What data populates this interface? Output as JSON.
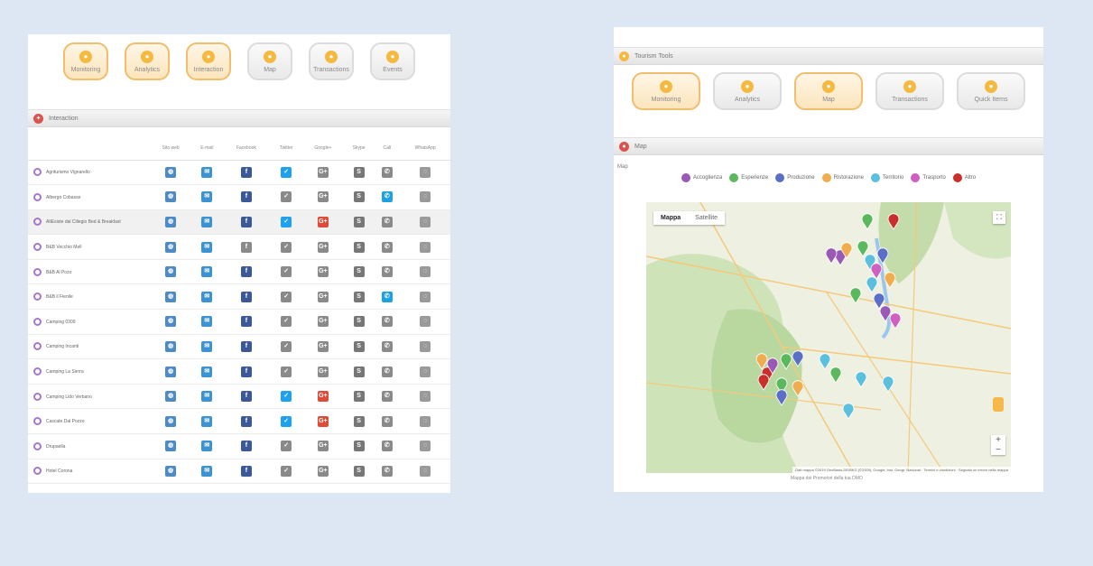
{
  "left": {
    "toolbar": [
      {
        "label": "Monitoring",
        "active": true
      },
      {
        "label": "Analytics",
        "active": true
      },
      {
        "label": "Interaction",
        "active": true
      },
      {
        "label": "Map",
        "active": false
      },
      {
        "label": "Transactions",
        "active": false
      },
      {
        "label": "Events",
        "active": false
      }
    ],
    "section_title": "Interaction",
    "columns": [
      "Sito web",
      "E-mail",
      "Facebook",
      "Twitter",
      "Google+",
      "Skype",
      "Call",
      "WhatsApp"
    ],
    "rows": [
      {
        "name": "Agriturismo Vignarello",
        "tw": true,
        "gp": false,
        "call": false
      },
      {
        "name": "Albergo Cobasse",
        "tw": false,
        "gp": false,
        "call": true
      },
      {
        "name": "AltEsiste dal Ciliegio Bed & Breakfast",
        "tw": true,
        "gp": true,
        "call": false
      },
      {
        "name": "B&B Vecchio Mell",
        "tw": false,
        "gp": false,
        "call": false
      },
      {
        "name": "B&B Al Pozo",
        "tw": false,
        "gp": false,
        "call": false
      },
      {
        "name": "B&B il Fienile",
        "tw": false,
        "gp": false,
        "call": true
      },
      {
        "name": "Camping 0309",
        "tw": false,
        "gp": false,
        "call": false
      },
      {
        "name": "Camping Incanti",
        "tw": false,
        "gp": false,
        "call": false
      },
      {
        "name": "Camping La Sierra",
        "tw": false,
        "gp": false,
        "call": false
      },
      {
        "name": "Camping Lido Verbano",
        "tw": true,
        "gp": true,
        "call": false
      },
      {
        "name": "Cascate Dal Pozzo",
        "tw": true,
        "gp": true,
        "call": false
      },
      {
        "name": "Drupaella",
        "tw": false,
        "gp": false,
        "call": false
      },
      {
        "name": "Hotel Corona",
        "tw": false,
        "gp": false,
        "call": false
      }
    ]
  },
  "right": {
    "top_title": "Tourism Tools",
    "toolbar": [
      {
        "label": "Monitoring",
        "active": true
      },
      {
        "label": "Analytics",
        "active": false
      },
      {
        "label": "Map",
        "active": true
      },
      {
        "label": "Transactions",
        "active": false
      },
      {
        "label": "Quick Items",
        "active": false
      }
    ],
    "section_title": "Map",
    "map_label": "Map",
    "legend": [
      {
        "label": "Accoglienza",
        "color": "#9b59b6"
      },
      {
        "label": "Esperienze",
        "color": "#5cb85c"
      },
      {
        "label": "Produzione",
        "color": "#5b6fc7"
      },
      {
        "label": "Ristorazione",
        "color": "#f0ad4e"
      },
      {
        "label": "Territorio",
        "color": "#5bc0de"
      },
      {
        "label": "Trasporto",
        "color": "#d05fc1"
      },
      {
        "label": "Altro",
        "color": "#c9302c"
      }
    ],
    "map_tabs": [
      "Mappa",
      "Satellite"
    ],
    "map_footer": "Mappa dei Promotori della tua DMO",
    "map_attribution": "Dati mappa ©2019 GeoBasis-DE/BKG (©2009), Google, Inst. Geogr. Nacional · Termini e condizioni · Segnala un errore nella mappa"
  }
}
